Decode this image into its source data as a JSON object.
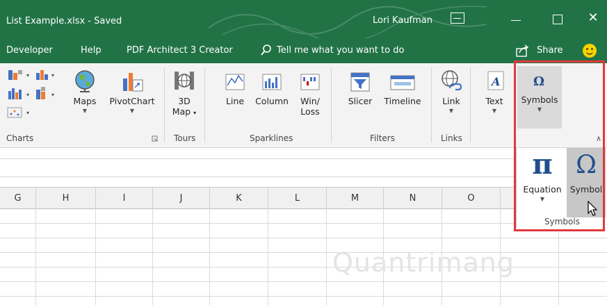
{
  "titlebar": {
    "filename": "List Example.xlsx  -  Saved",
    "user": "Lori Kaufman",
    "close_glyph": "✕"
  },
  "tabs": {
    "developer": "Developer",
    "help": "Help",
    "pdf": "PDF Architect 3 Creator",
    "tellme": "Tell me what you want to do",
    "share": "Share"
  },
  "ribbon": {
    "maps": "Maps",
    "pivotchart": "PivotChart",
    "map3d_line1": "3D",
    "map3d_line2": "Map",
    "line": "Line",
    "column": "Column",
    "winloss_line1": "Win/",
    "winloss_line2": "Loss",
    "slicer": "Slicer",
    "timeline": "Timeline",
    "link": "Link",
    "text": "Text",
    "symbols": "Symbols",
    "groups": {
      "charts": "Charts",
      "tours": "Tours",
      "sparklines": "Sparklines",
      "filters": "Filters",
      "links": "Links"
    }
  },
  "popup": {
    "equation": "Equation",
    "symbol": "Symbol",
    "group": "Symbols",
    "pi_glyph": "π",
    "omega_glyph": "Ω"
  },
  "columns": [
    "G",
    "H",
    "I",
    "J",
    "K",
    "L",
    "M",
    "N",
    "O"
  ],
  "watermark": "Quantrimang",
  "colors": {
    "excel_green": "#217346",
    "highlight_red": "#e0393b",
    "symbol_blue": "#1f4e8c"
  }
}
